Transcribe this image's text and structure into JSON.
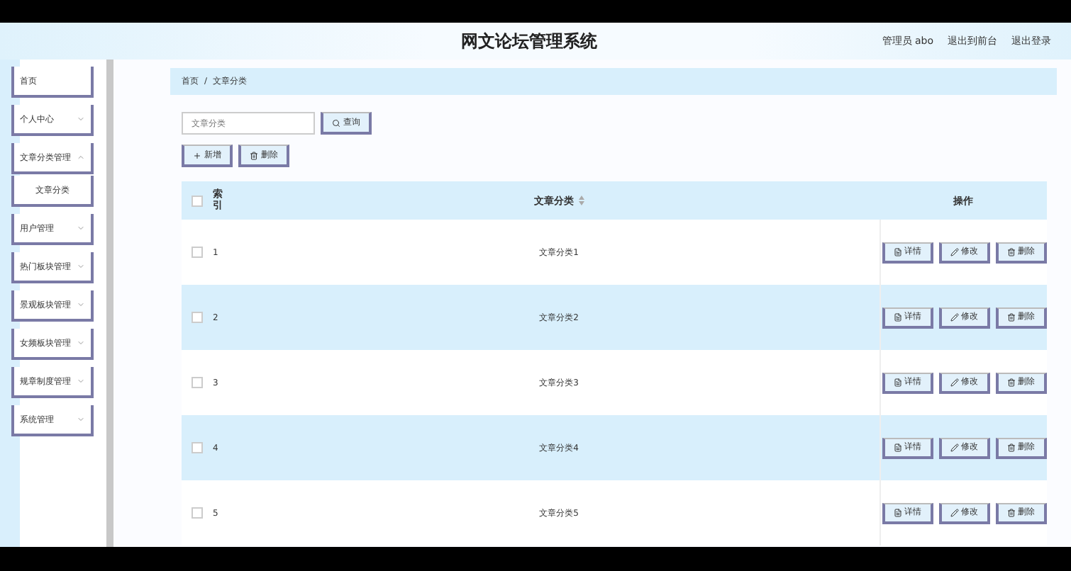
{
  "header": {
    "title": "网文论坛管理系统",
    "user": "管理员 abo",
    "links": [
      "退出到前台",
      "退出登录"
    ]
  },
  "sidebar": {
    "items": [
      {
        "label": "首页",
        "has_arrow": false
      },
      {
        "label": "个人中心",
        "expanded": false,
        "has_arrow": true
      },
      {
        "label": "文章分类管理",
        "expanded": true,
        "has_arrow": true,
        "children": [
          {
            "label": "文章分类"
          }
        ]
      },
      {
        "label": "用户管理",
        "expanded": false,
        "has_arrow": true
      },
      {
        "label": "热门板块管理",
        "expanded": false,
        "has_arrow": true
      },
      {
        "label": "景观板块管理",
        "expanded": false,
        "has_arrow": true
      },
      {
        "label": "女频板块管理",
        "expanded": false,
        "has_arrow": true
      },
      {
        "label": "规章制度管理",
        "expanded": false,
        "has_arrow": true
      },
      {
        "label": "系统管理",
        "expanded": false,
        "has_arrow": true
      }
    ]
  },
  "breadcrumb": {
    "items": [
      "首页",
      "文章分类"
    ],
    "separator": "/"
  },
  "search": {
    "placeholder": "文章分类",
    "button": "查询"
  },
  "actions": [
    "新增",
    "删除"
  ],
  "table": {
    "all_checked": false,
    "columns": [
      "索引",
      "文章分类",
      "操作"
    ],
    "rows": [
      {
        "index": "1",
        "name": "文章分类1",
        "checked": false,
        "buttons": [
          "详情",
          "修改",
          "删除"
        ]
      },
      {
        "index": "2",
        "name": "文章分类2",
        "checked": false,
        "buttons": [
          "详情",
          "修改",
          "删除"
        ]
      },
      {
        "index": "3",
        "name": "文章分类3",
        "checked": false,
        "buttons": [
          "详情",
          "修改",
          "删除"
        ]
      },
      {
        "index": "4",
        "name": "文章分类4",
        "checked": false,
        "buttons": [
          "详情",
          "修改",
          "删除"
        ]
      },
      {
        "index": "5",
        "name": "文章分类5",
        "checked": false,
        "buttons": [
          "详情",
          "修改",
          "删除"
        ]
      }
    ]
  }
}
